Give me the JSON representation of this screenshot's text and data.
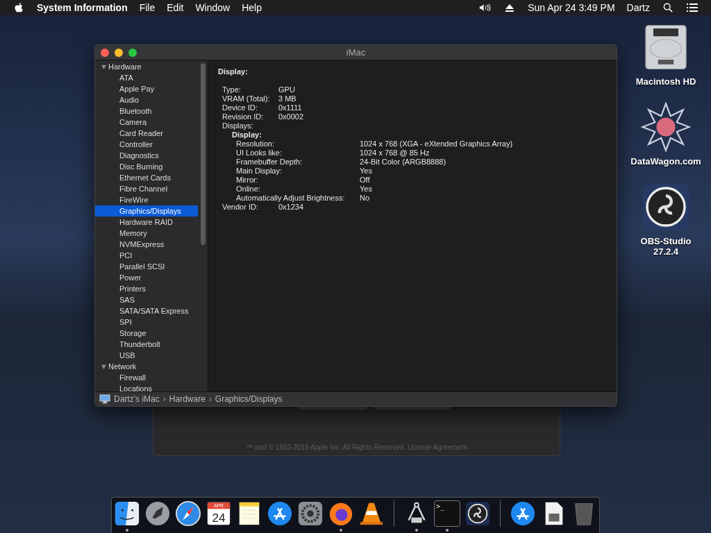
{
  "menu_bar": {
    "app_name": "System Information",
    "menus": [
      "File",
      "Edit",
      "Window",
      "Help"
    ],
    "clock": "Sun Apr 24  3:49 PM",
    "user": "Dartz"
  },
  "desktop_icons": [
    {
      "kind": "drive",
      "label": "Macintosh HD"
    },
    {
      "kind": "star",
      "label": "DataWagon.com"
    },
    {
      "kind": "obs",
      "label": "OBS-Studio\n27.2.4"
    }
  ],
  "back_window": {
    "footer": "™ and © 1983-2019 Apple Inc. All Rights Reserved.",
    "footer_link": "License Agreement"
  },
  "window": {
    "title": "iMac",
    "sidebar": [
      {
        "label": "Hardware",
        "expanded": true,
        "children": [
          {
            "label": "ATA",
            "selected": false
          },
          {
            "label": "Apple Pay",
            "selected": false
          },
          {
            "label": "Audio",
            "selected": false
          },
          {
            "label": "Bluetooth",
            "selected": false
          },
          {
            "label": "Camera",
            "selected": false
          },
          {
            "label": "Card Reader",
            "selected": false
          },
          {
            "label": "Controller",
            "selected": false
          },
          {
            "label": "Diagnostics",
            "selected": false
          },
          {
            "label": "Disc Burning",
            "selected": false
          },
          {
            "label": "Ethernet Cards",
            "selected": false
          },
          {
            "label": "Fibre Channel",
            "selected": false
          },
          {
            "label": "FireWire",
            "selected": false
          },
          {
            "label": "Graphics/Displays",
            "selected": true
          },
          {
            "label": "Hardware RAID",
            "selected": false
          },
          {
            "label": "Memory",
            "selected": false
          },
          {
            "label": "NVMExpress",
            "selected": false
          },
          {
            "label": "PCI",
            "selected": false
          },
          {
            "label": "Parallel SCSI",
            "selected": false
          },
          {
            "label": "Power",
            "selected": false
          },
          {
            "label": "Printers",
            "selected": false
          },
          {
            "label": "SAS",
            "selected": false
          },
          {
            "label": "SATA/SATA Express",
            "selected": false
          },
          {
            "label": "SPI",
            "selected": false
          },
          {
            "label": "Storage",
            "selected": false
          },
          {
            "label": "Thunderbolt",
            "selected": false
          },
          {
            "label": "USB",
            "selected": false
          }
        ]
      },
      {
        "label": "Network",
        "expanded": true,
        "children": [
          {
            "label": "Firewall",
            "selected": false
          },
          {
            "label": "Locations",
            "selected": false
          }
        ]
      }
    ],
    "detail": {
      "heading": "Display:",
      "rows": [
        {
          "label": "Type:",
          "value": "GPU"
        },
        {
          "label": "VRAM (Total):",
          "value": "3 MB"
        },
        {
          "label": "Device ID:",
          "value": "0x1111"
        },
        {
          "label": "Revision ID:",
          "value": "0x0002"
        },
        {
          "label": "Displays:",
          "children": [
            {
              "heading": "Display:",
              "rows": [
                {
                  "label": "Resolution:",
                  "value": "1024 x 768 (XGA - eXtended Graphics Array)"
                },
                {
                  "label": "UI Looks like:",
                  "value": "1024 x 768 @ 85 Hz"
                },
                {
                  "label": "Framebuffer Depth:",
                  "value": "24-Bit Color (ARGB8888)"
                },
                {
                  "label": "Main Display:",
                  "value": "Yes"
                },
                {
                  "label": "Mirror:",
                  "value": "Off"
                },
                {
                  "label": "Online:",
                  "value": "Yes"
                },
                {
                  "label": "Automatically Adjust Brightness:",
                  "value": "No"
                }
              ]
            }
          ]
        },
        {
          "label": "Vendor ID:",
          "value": "0x1234"
        }
      ]
    },
    "path": [
      {
        "label": "Dartz’s iMac"
      },
      {
        "separator": "›",
        "label": "Hardware"
      },
      {
        "separator": "›",
        "label": "Graphics/Displays"
      }
    ]
  },
  "dock": [
    {
      "kind": "finder",
      "running": true
    },
    {
      "kind": "rocket",
      "running": false
    },
    {
      "kind": "compass",
      "running": false
    },
    {
      "kind": "calendar",
      "month": "APR",
      "day": "24",
      "running": false
    },
    {
      "kind": "notes",
      "running": false
    },
    {
      "kind": "appstore",
      "running": false
    },
    {
      "kind": "gear",
      "running": false
    },
    {
      "kind": "fox",
      "running": true
    },
    {
      "kind": "cone",
      "running": false
    },
    {
      "kind": "separator"
    },
    {
      "kind": "calipers",
      "running": true
    },
    {
      "kind": "terminal",
      "prompt": ">_",
      "running": true
    },
    {
      "kind": "obs",
      "running": false
    },
    {
      "kind": "separator"
    },
    {
      "kind": "appstore",
      "running": false
    },
    {
      "kind": "document",
      "running": false
    },
    {
      "kind": "trash",
      "running": false
    }
  ]
}
